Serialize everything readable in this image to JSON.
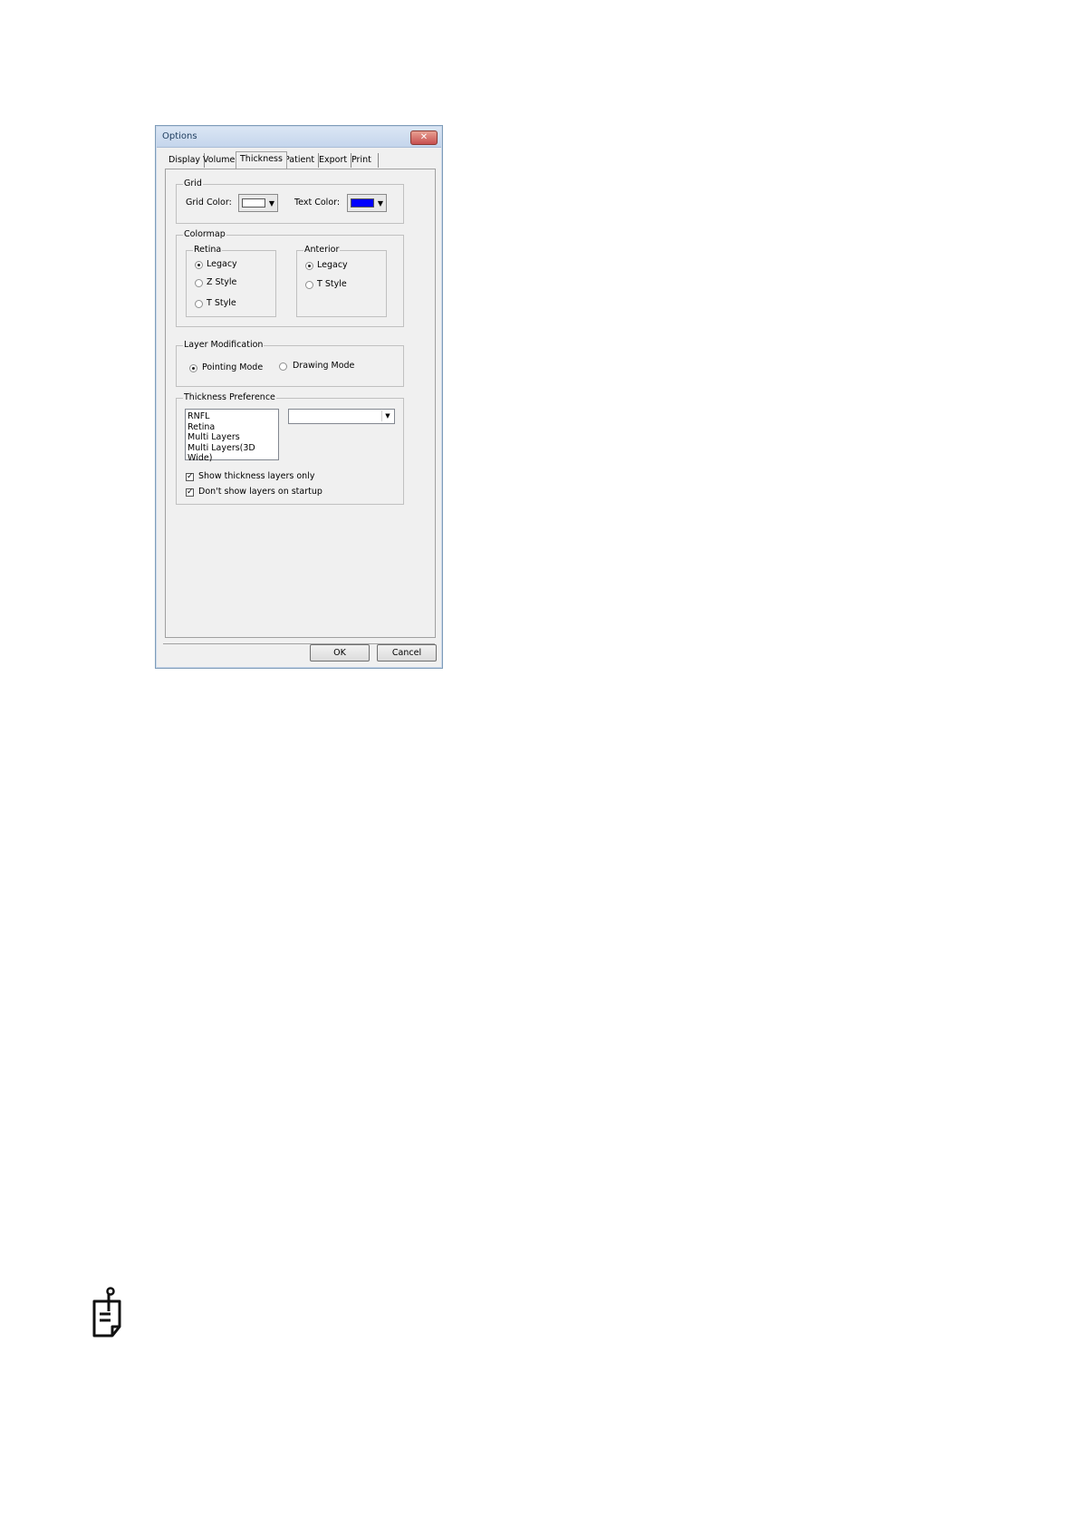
{
  "window": {
    "title": "Options",
    "close_glyph": "✕"
  },
  "tabs": [
    {
      "label": "Display",
      "active": false
    },
    {
      "label": "Volume",
      "active": false
    },
    {
      "label": "Thickness",
      "active": true
    },
    {
      "label": "Patient",
      "active": false
    },
    {
      "label": "Export",
      "active": false
    },
    {
      "label": "Print",
      "active": false
    }
  ],
  "grid": {
    "legend": "Grid",
    "grid_color_label": "Grid Color:",
    "grid_color_value": "#ffffff",
    "text_color_label": "Text Color:",
    "text_color_value": "#0000ff"
  },
  "colormap": {
    "legend": "Colormap",
    "retina": {
      "legend": "Retina",
      "options": [
        {
          "label": "Legacy",
          "selected": true
        },
        {
          "label": "Z Style",
          "selected": false
        },
        {
          "label": "T Style",
          "selected": false
        }
      ]
    },
    "anterior": {
      "legend": "Anterior",
      "options": [
        {
          "label": "Legacy",
          "selected": true
        },
        {
          "label": "T Style",
          "selected": false
        }
      ]
    }
  },
  "layer_modification": {
    "legend": "Layer Modification",
    "pointing_mode": "Pointing Mode",
    "drawing_mode": "Drawing Mode",
    "selected": "Pointing Mode"
  },
  "thickness_preference": {
    "legend": "Thickness Preference",
    "list": [
      "RNFL",
      "Retina",
      "Multi Layers",
      "Multi Layers(3D Wide)"
    ],
    "combo_value": "",
    "show_thickness_layers_only": {
      "label": "Show thickness layers only",
      "checked": true
    },
    "dont_show_layers_on_startup": {
      "label": "Don't show layers on startup",
      "checked": true
    }
  },
  "buttons": {
    "ok": "OK",
    "cancel": "Cancel"
  },
  "icons": {
    "note": "note-pencil-icon"
  }
}
